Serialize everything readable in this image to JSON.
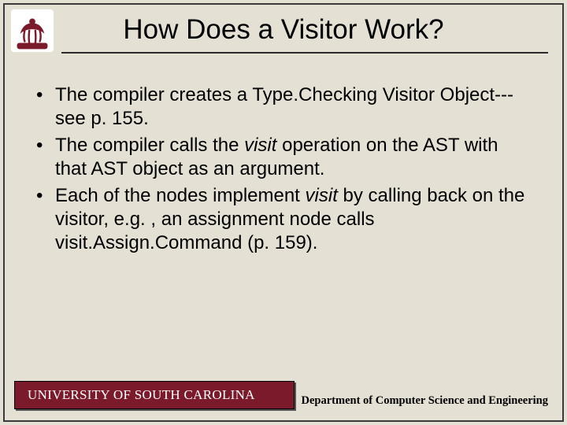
{
  "title": "How Does a Visitor Work?",
  "bullets": [
    {
      "pre": "The compiler creates a Type.Checking Visitor Object---see p. 155.",
      "italic": "",
      "post": ""
    },
    {
      "pre": "The compiler calls the ",
      "italic": "visit",
      "post": " operation on the AST with that AST object as an argument."
    },
    {
      "pre": "Each of the nodes implement ",
      "italic": "visit",
      "post": " by calling back on the visitor, e.g. , an assignment node calls visit.Assign.Command (p. 159)."
    }
  ],
  "footer": {
    "left": "UNIVERSITY OF SOUTH CAROLINA",
    "right": "Department of Computer Science and Engineering"
  },
  "colors": {
    "background": "#e4e0d4",
    "accent": "#7a1a2b"
  }
}
